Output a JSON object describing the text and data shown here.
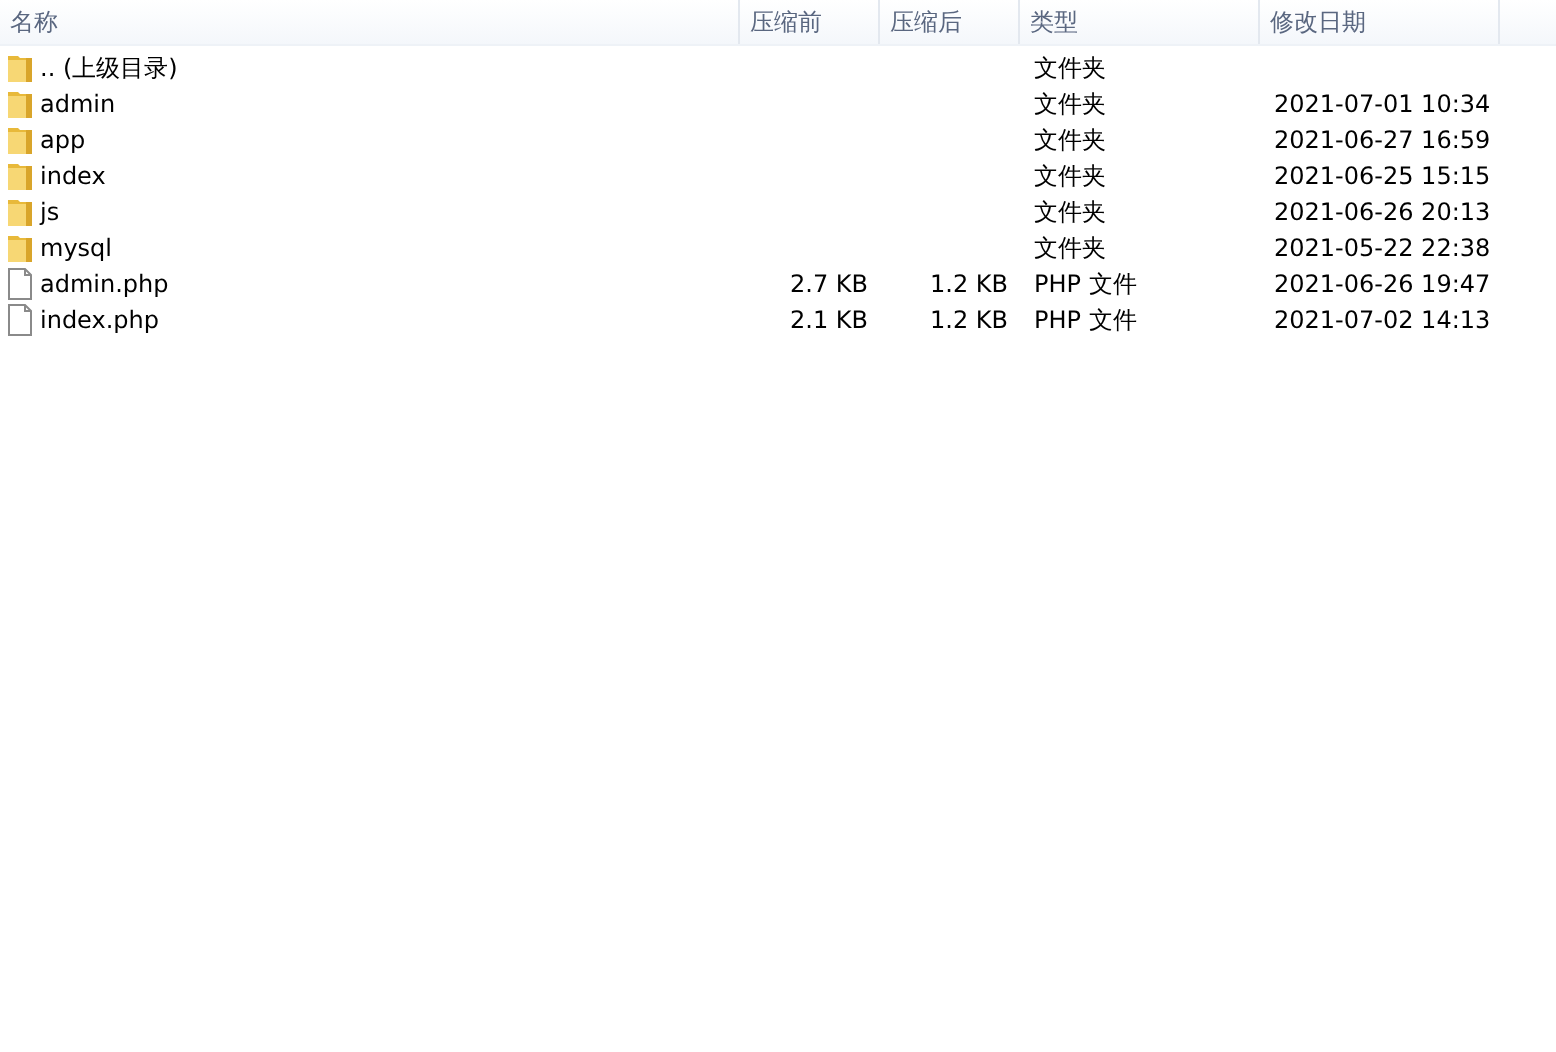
{
  "columns": [
    "名称",
    "压缩前",
    "压缩后",
    "类型",
    "修改日期"
  ],
  "files": [
    {
      "kind": "folder",
      "name": ".. (上级目录)",
      "type": "文件夹"
    },
    {
      "kind": "folder",
      "name": "admin",
      "type": "文件夹",
      "modified": "2021-07-01 10:34"
    },
    {
      "kind": "folder",
      "name": "app",
      "type": "文件夹",
      "modified": "2021-06-27 16:59"
    },
    {
      "kind": "folder",
      "name": "index",
      "type": "文件夹",
      "modified": "2021-06-25 15:15"
    },
    {
      "kind": "folder",
      "name": "js",
      "type": "文件夹",
      "modified": "2021-06-26 20:13"
    },
    {
      "kind": "folder",
      "name": "mysql",
      "type": "文件夹",
      "modified": "2021-05-22 22:38"
    },
    {
      "kind": "file",
      "name": "admin.php",
      "size": "2.7 KB",
      "packed": "1.2 KB",
      "type": "PHP 文件",
      "modified": "2021-06-26 19:47"
    },
    {
      "kind": "file",
      "name": "index.php",
      "size": "2.1 KB",
      "packed": "1.2 KB",
      "type": "PHP 文件",
      "modified": "2021-07-02 14:13"
    }
  ]
}
